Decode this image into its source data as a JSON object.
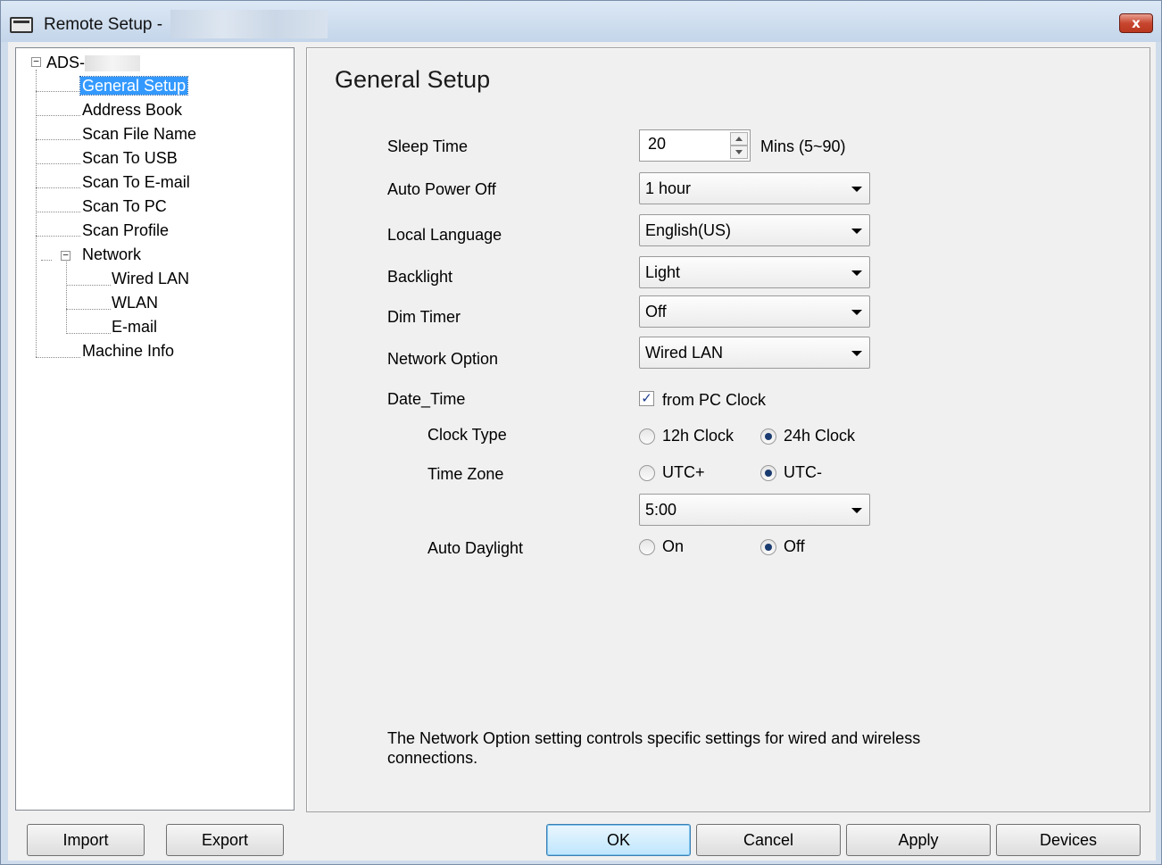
{
  "window": {
    "title": "Remote Setup -",
    "close_glyph": "x"
  },
  "tree": {
    "root": "ADS-",
    "items": [
      {
        "label": "General Setup"
      },
      {
        "label": "Address Book"
      },
      {
        "label": "Scan File Name"
      },
      {
        "label": "Scan To USB"
      },
      {
        "label": "Scan To E-mail"
      },
      {
        "label": "Scan To PC"
      },
      {
        "label": "Scan Profile"
      },
      {
        "label": "Network"
      },
      {
        "label": "Wired LAN"
      },
      {
        "label": "WLAN"
      },
      {
        "label": "E-mail"
      },
      {
        "label": "Machine Info"
      }
    ],
    "selected": "General Setup"
  },
  "panel": {
    "title": "General Setup",
    "sleep_time": {
      "label": "Sleep Time",
      "value": "20",
      "unit": "Mins (5~90)"
    },
    "auto_power_off": {
      "label": "Auto Power Off",
      "value": "1 hour"
    },
    "local_language": {
      "label": "Local Language",
      "value": "English(US)"
    },
    "backlight": {
      "label": "Backlight",
      "value": "Light"
    },
    "dim_timer": {
      "label": "Dim Timer",
      "value": "Off"
    },
    "network_option": {
      "label": "Network Option",
      "value": "Wired LAN"
    },
    "date_time": {
      "label": "Date_Time",
      "checkbox_label": "from PC Clock",
      "checked": true
    },
    "clock_type": {
      "label": "Clock Type",
      "options": [
        "12h Clock",
        "24h Clock"
      ],
      "selected": "24h Clock"
    },
    "time_zone": {
      "label": "Time Zone",
      "options": [
        "UTC+",
        "UTC-"
      ],
      "selected": "UTC-",
      "offset": "5:00"
    },
    "auto_daylight": {
      "label": "Auto Daylight",
      "options": [
        "On",
        "Off"
      ],
      "selected": "Off"
    },
    "note": "The Network Option setting controls specific settings for wired and wireless connections."
  },
  "buttons": {
    "import": "Import",
    "export": "Export",
    "ok": "OK",
    "cancel": "Cancel",
    "apply": "Apply",
    "devices": "Devices"
  },
  "colors": {
    "selection": "#3399ff",
    "close_button": "#c8462f",
    "titlebar": "#cfdcec"
  }
}
